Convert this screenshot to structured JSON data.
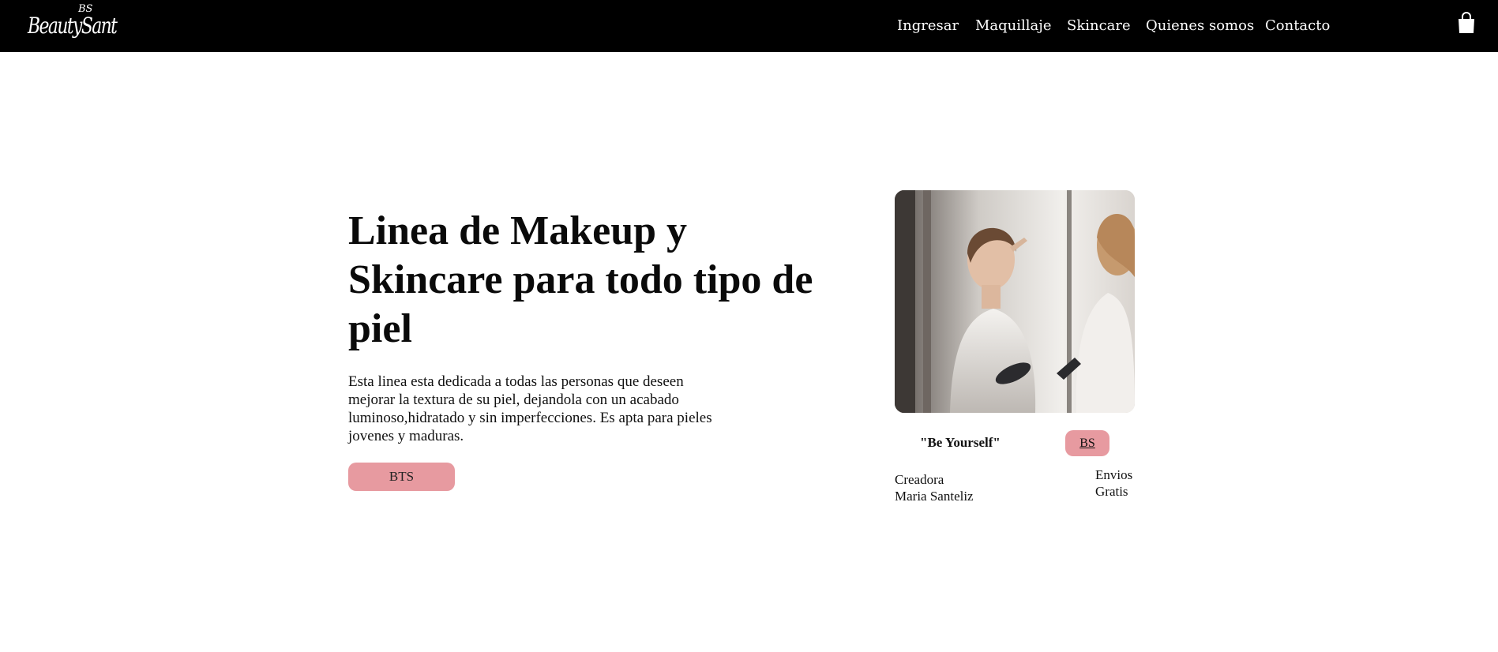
{
  "brand": {
    "logo_main": "BeautySant",
    "logo_top": "BS"
  },
  "nav": {
    "items": [
      "Ingresar",
      "Maquillaje",
      "Skincare",
      "Quienes somos",
      "Contacto"
    ]
  },
  "icons": {
    "cart": "shopping-bag-icon"
  },
  "hero": {
    "title": "Linea de Makeup y Skincare para todo tipo de piel",
    "description": "Esta linea esta dedicada a todas las personas que deseen mejorar la textura de su piel, dejandola con un acabado luminoso,hidratado y sin imperfecciones. Es apta para pieles jovenes y maduras.",
    "button_label": "BTS"
  },
  "card": {
    "quote": "\"Be Yourself\"",
    "button_label": "BS",
    "creator_label": "Creadora",
    "creator_name": "Maria Santeliz",
    "shipping_line1": "Envios",
    "shipping_line2": "Gratis"
  },
  "colors": {
    "navbar_bg": "#000000",
    "accent_pink": "#e79aa0",
    "text": "#111111"
  }
}
